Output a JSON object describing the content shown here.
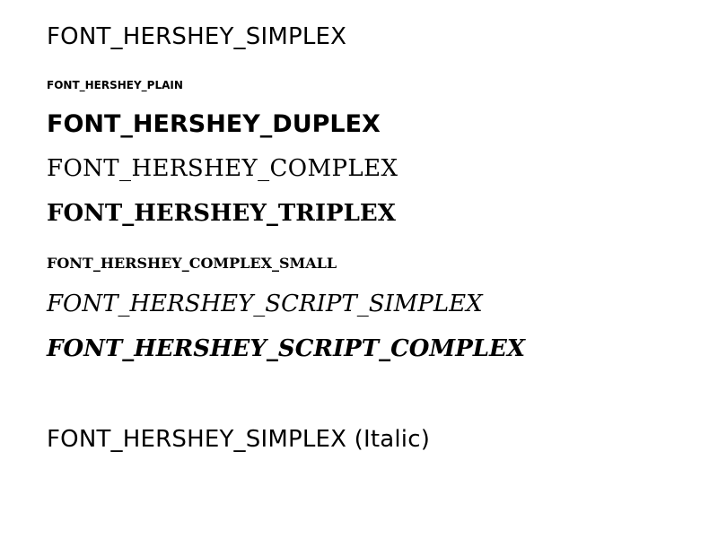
{
  "samples": {
    "simplex": "FONT_HERSHEY_SIMPLEX",
    "plain": "FONT_HERSHEY_PLAIN",
    "duplex": "FONT_HERSHEY_DUPLEX",
    "complex": "FONT_HERSHEY_COMPLEX",
    "triplex": "FONT_HERSHEY_TRIPLEX",
    "complex_small": "FONT_HERSHEY_COMPLEX_SMALL",
    "script_simplex": "FONT_HERSHEY_SCRIPT_SIMPLEX",
    "script_complex": "FONT_HERSHEY_SCRIPT_COMPLEX",
    "simplex_italic": "FONT_HERSHEY_SIMPLEX  (Italic)"
  },
  "colors": {
    "background": "#ffffff",
    "text": "#000000"
  }
}
